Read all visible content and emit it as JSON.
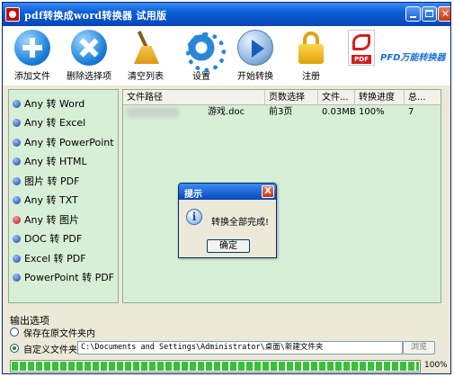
{
  "window": {
    "title": "pdf转换成word转换器 试用版"
  },
  "toolbar": {
    "add_files": "添加文件",
    "remove_selected": "删除选择项",
    "clear_list": "清空列表",
    "settings": "设置",
    "start_convert": "开始转换",
    "register": "注册",
    "brand_badge": "PDF",
    "brand_name": "PFD万能转换器"
  },
  "modes": [
    {
      "label": "Any 转 Word",
      "active": false
    },
    {
      "label": "Any 转 Excel",
      "active": false
    },
    {
      "label": "Any 转 PowerPoint",
      "active": false
    },
    {
      "label": "Any 转 HTML",
      "active": false
    },
    {
      "label": "图片 转 PDF",
      "active": false
    },
    {
      "label": "Any 转 TXT",
      "active": false
    },
    {
      "label": "Any 转 图片",
      "active": true
    },
    {
      "label": "DOC 转 PDF",
      "active": false
    },
    {
      "label": "Excel 转 PDF",
      "active": false
    },
    {
      "label": "PowerPoint 转 PDF",
      "active": false
    }
  ],
  "file_list": {
    "columns": [
      "文件路径",
      "页数选择",
      "文件...",
      "转换进度",
      "总..."
    ],
    "rows": [
      {
        "path": "游戏.doc",
        "pages": "前3页",
        "size": "0.03MB",
        "progress": "100%",
        "total": "7"
      }
    ]
  },
  "dialog": {
    "title": "提示",
    "message": "转换全部完成!",
    "ok": "确定",
    "close": "X"
  },
  "output": {
    "label": "输出选项",
    "option_same_folder": "保存在原文件夹内",
    "option_custom_folder": "自定义文件夹",
    "selected": "custom",
    "path": "C:\\Documents and Settings\\Administrator\\桌面\\新建文件夹",
    "browse": "浏览"
  },
  "progress": {
    "value": 1.0,
    "label": "100%"
  },
  "colors": {
    "titlebar": "#0a5fd8",
    "panel": "#d6efd6",
    "progress": "#35c235",
    "brand": "#1d6fd1"
  }
}
